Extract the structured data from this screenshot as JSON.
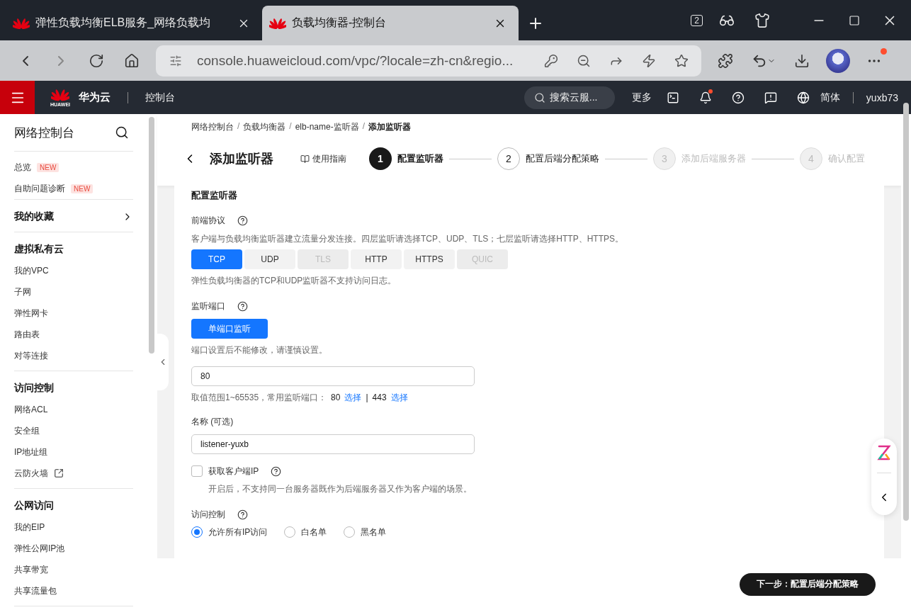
{
  "browser": {
    "tabs": [
      {
        "title": "弹性负载均衡ELB服务_网络负载均",
        "selected": false
      },
      {
        "title": "负载均衡器-控制台",
        "selected": true
      }
    ],
    "window_count": "2",
    "address": "console.huaweicloud.com/vpc/?locale=zh-cn&regio..."
  },
  "console_header": {
    "logo_text": "HUAWEI",
    "brand": "华为云",
    "section": "控制台",
    "search_placeholder": "搜索云服...",
    "more": "更多",
    "notification_dot": true,
    "language": "简体",
    "user": "yuxb73"
  },
  "sidebar": {
    "title": "网络控制台",
    "groups": [
      {
        "items": [
          {
            "label": "总览",
            "badge": "NEW",
            "external": false
          },
          {
            "label": "自助问题诊断",
            "badge": "NEW",
            "external": false
          }
        ]
      },
      {
        "heading": "我的收藏",
        "collapsible": true
      },
      {
        "heading": "虚拟私有云",
        "items": [
          {
            "label": "我的VPC",
            "external": false
          },
          {
            "label": "子网",
            "external": false
          },
          {
            "label": "弹性网卡",
            "external": false
          },
          {
            "label": "路由表",
            "external": false
          },
          {
            "label": "对等连接",
            "external": false
          }
        ]
      },
      {
        "heading": "访问控制",
        "items": [
          {
            "label": "网络ACL",
            "external": false
          },
          {
            "label": "安全组",
            "external": false
          },
          {
            "label": "IP地址组",
            "external": false
          },
          {
            "label": "云防火墙",
            "external": true
          }
        ]
      },
      {
        "heading": "公网访问",
        "items": [
          {
            "label": "我的EIP",
            "external": false
          },
          {
            "label": "弹性公网IP池",
            "external": false
          },
          {
            "label": "共享带宽",
            "external": false
          },
          {
            "label": "共享流量包",
            "external": false
          }
        ]
      }
    ]
  },
  "breadcrumb": [
    "网络控制台",
    "负载均衡器",
    "elb-name-监听器",
    "添加监听器"
  ],
  "breadcrumb_separator": "/",
  "page_title": "添加监听器",
  "guide_link": "使用指南",
  "steps": [
    {
      "number": "1",
      "label": "配置监听器",
      "current": true,
      "disabled": false
    },
    {
      "number": "2",
      "label": "配置后端分配策略",
      "current": false,
      "disabled": false
    },
    {
      "number": "3",
      "label": "添加后端服务器",
      "current": false,
      "disabled": true
    },
    {
      "number": "4",
      "label": "确认配置",
      "current": false,
      "disabled": true
    }
  ],
  "form": {
    "section_title": "配置监听器",
    "protocol": {
      "label": "前端协议",
      "description": "客户端与负载均衡监听器建立流量分发连接。四层监听请选择TCP、UDP、TLS；七层监听请选择HTTP、HTTPS。",
      "options": [
        {
          "label": "TCP",
          "selected": true,
          "disabled": false
        },
        {
          "label": "UDP",
          "selected": false,
          "disabled": false
        },
        {
          "label": "TLS",
          "selected": false,
          "disabled": true
        },
        {
          "label": "HTTP",
          "selected": false,
          "disabled": false
        },
        {
          "label": "HTTPS",
          "selected": false,
          "disabled": false
        },
        {
          "label": "QUIC",
          "selected": false,
          "disabled": true
        }
      ],
      "note": "弹性负载均衡器的TCP和UDP监听器不支持访问日志。"
    },
    "port": {
      "label": "监听端口",
      "mode_button": "单端口监听",
      "note": "端口设置后不能修改，请谨慎设置。",
      "value": "80",
      "hint": "取值范围1~65535，常用监听端口：",
      "quick_ports": [
        {
          "port": "80",
          "link": "选择"
        },
        {
          "port": "443",
          "link": "选择"
        }
      ],
      "separator": "|"
    },
    "name": {
      "label": "名称 (可选)",
      "value": "listener-yuxb"
    },
    "client_ip": {
      "label": "获取客户端IP",
      "checked": false,
      "description": "开启后，不支持同一台服务器既作为后端服务器又作为客户端的场景。"
    },
    "access_control": {
      "label": "访问控制",
      "options": [
        {
          "label": "允许所有IP访问",
          "selected": true
        },
        {
          "label": "白名单",
          "selected": false
        },
        {
          "label": "黑名单",
          "selected": false
        }
      ]
    }
  },
  "footer": {
    "next_button": "下一步：配置后端分配策略"
  }
}
